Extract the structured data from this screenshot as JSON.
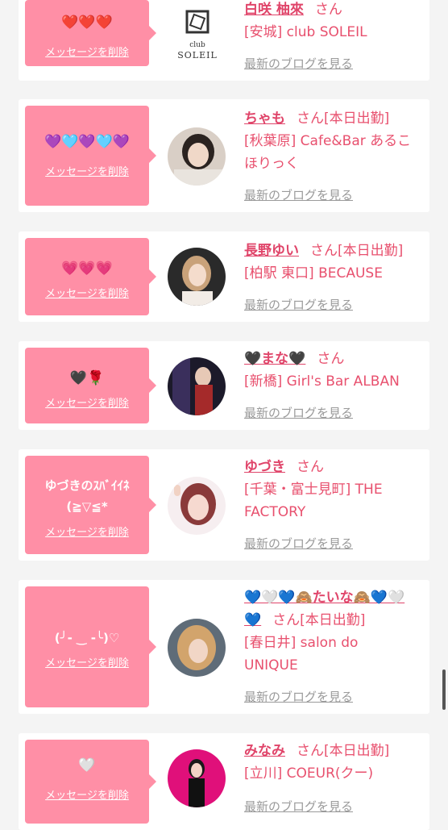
{
  "delete_label": "メッセージを削除",
  "blog_label": "最新のブログを見る",
  "colors": {
    "bubble": "#ff8fa6",
    "accent": "#e0456a",
    "muted": "#9a9a9a"
  },
  "items": [
    {
      "message": "❤️❤️❤️",
      "name": "白咲 柚來",
      "suffix": "さん",
      "shop": "[安城] club SOLEIL",
      "avatar": "club-soleil-logo"
    },
    {
      "message": "💜🩵💜🩵💜",
      "name": "ちゃも",
      "suffix": "さん[本日出勤]",
      "shop": "[秋葉原] Cafe&Bar あるこほりっく",
      "avatar": "photo"
    },
    {
      "message": "💗💗💗",
      "name": "長野ゆい",
      "suffix": "さん[本日出勤]",
      "shop": "[柏駅 東口] BECAUSE",
      "avatar": "photo"
    },
    {
      "message": "🖤🌹",
      "name": "🖤まな🖤",
      "suffix": "さん",
      "shop": "[新橋] Girl's Bar ALBAN",
      "avatar": "photo"
    },
    {
      "message": "ゆづきのｽﾊﾞｲｲﾈ\n(≧▽≦*",
      "name": "ゆづき",
      "suffix": "さん",
      "shop": "[千葉・富士見町] THE FACTORY",
      "avatar": "photo"
    },
    {
      "message": "(╯- ‿ -╰)♡",
      "name": "💙🤍💙🙈たいな🙈💙🤍💙",
      "suffix": "さん[本日出勤]",
      "shop": "[春日井] salon do UNIQUE",
      "avatar": "photo"
    },
    {
      "message": "🤍",
      "name": "みなみ",
      "suffix": "さん[本日出勤]",
      "shop": "[立川] COEUR(クー)",
      "avatar": "photo"
    }
  ]
}
